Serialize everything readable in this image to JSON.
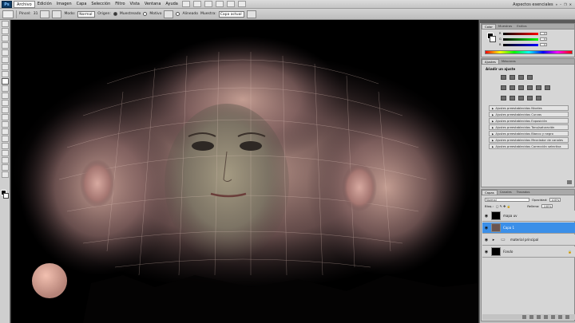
{
  "menubar": {
    "logo": "Ps",
    "items": [
      "Archivo",
      "Edición",
      "Imagen",
      "Capa",
      "Selección",
      "Filtro",
      "Vista",
      "Ventana",
      "Ayuda"
    ],
    "workspace": "Aspectos esenciales"
  },
  "options": {
    "pincel_label": "Pincel:",
    "pincel_size": "31",
    "modo_label": "Modo:",
    "modo_value": "Normal",
    "origen_label": "Origen:",
    "origen_a": "Muestreado",
    "origen_b": "Motivo",
    "alineado": "Alineado",
    "muestra_label": "Muestra:",
    "muestra_value": "Capa actual"
  },
  "color_panel": {
    "tabs": [
      "Color",
      "Muestras",
      "Estilos"
    ],
    "channels": [
      {
        "label": "R",
        "value": "0",
        "gradient": "linear-gradient(90deg,#000,#f00)"
      },
      {
        "label": "G",
        "value": "0",
        "gradient": "linear-gradient(90deg,#000,#0f0)"
      },
      {
        "label": "B",
        "value": "0",
        "gradient": "linear-gradient(90deg,#000,#00f)"
      }
    ]
  },
  "adjust_panel": {
    "tabs": [
      "Ajustes",
      "Máscaras"
    ],
    "title": "Añadir un ajuste",
    "presets": [
      "Ajustes preestablecidos Niveles",
      "Ajustes preestablecidos Curvas",
      "Ajustes preestablecidos Exposición",
      "Ajustes preestablecidos Tono/saturación",
      "Ajustes preestablecidos Blanco y negro",
      "Ajustes preestablecidos Mezclador de canales",
      "Ajustes preestablecidos Corrección selectiva"
    ]
  },
  "layers_panel": {
    "tabs": [
      "Capas",
      "Canales",
      "Trazados"
    ],
    "blend": "Normal",
    "opacity_label": "Opacidad:",
    "opacity_value": "100%",
    "lock_label": "Bloq.:",
    "fill_label": "Relleno:",
    "fill_value": "100%",
    "layers": [
      {
        "name": "mapa uv",
        "selected": false,
        "thumb": "black"
      },
      {
        "name": "Capa 1",
        "selected": true,
        "thumb": "face"
      },
      {
        "name": "material principal",
        "selected": false,
        "thumb": "folder"
      },
      {
        "name": "Fondo",
        "selected": false,
        "thumb": "black"
      }
    ]
  },
  "colors": {
    "selection_blue": "#3b8fe8",
    "skin": "#c99a8a",
    "wire": "#d8b8b0"
  }
}
